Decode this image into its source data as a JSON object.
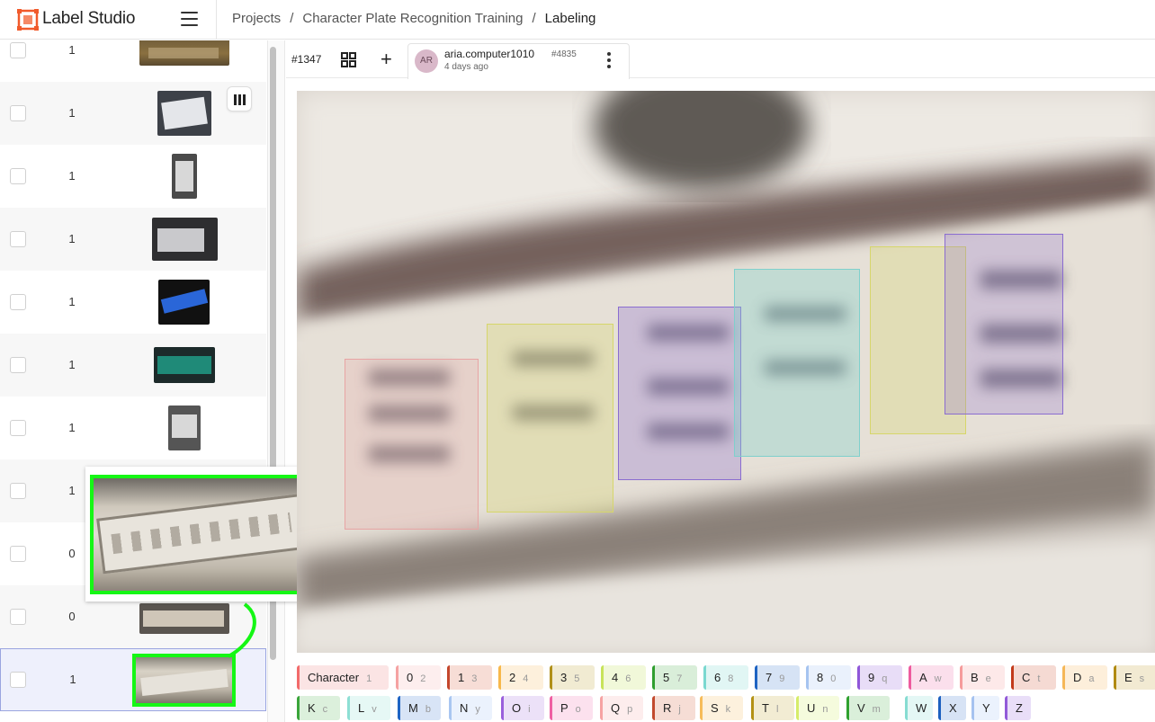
{
  "app": {
    "brand": "Label Studio"
  },
  "breadcrumb": {
    "projects": "Projects",
    "project": "Character Plate Recognition Training",
    "current": "Labeling"
  },
  "tasks": [
    {
      "count": "1"
    },
    {
      "count": "1"
    },
    {
      "count": "1"
    },
    {
      "count": "1"
    },
    {
      "count": "1"
    },
    {
      "count": "1"
    },
    {
      "count": "1"
    },
    {
      "count": "1"
    },
    {
      "count": "0"
    },
    {
      "count": "0"
    },
    {
      "count": "1"
    }
  ],
  "toolbar": {
    "task_id": "#1347"
  },
  "annotation": {
    "avatar": "AR",
    "user": "aria.computer1010",
    "id": "#4835",
    "time": "4 days ago"
  },
  "colors": {
    "accent_green": "#15f715",
    "box_pink": "#e8a4a4",
    "box_yellow": "#d6d66a",
    "box_purple": "#8a6cd0",
    "box_teal": "#7fd0cc"
  },
  "labels": [
    {
      "name": "Character",
      "key": "1",
      "color": "#f26b6b",
      "bg": "#fbe4e4"
    },
    {
      "name": "0",
      "key": "2",
      "color": "#f5a3a3",
      "bg": "#fdeeee"
    },
    {
      "name": "1",
      "key": "3",
      "color": "#c4472d",
      "bg": "#f7ddd6"
    },
    {
      "name": "2",
      "key": "4",
      "color": "#f7b84b",
      "bg": "#fdf0dc"
    },
    {
      "name": "3",
      "key": "5",
      "color": "#b09019",
      "bg": "#f1ebd2"
    },
    {
      "name": "4",
      "key": "6",
      "color": "#c7e35a",
      "bg": "#f1f8d9"
    },
    {
      "name": "5",
      "key": "7",
      "color": "#2f9e2f",
      "bg": "#d9eed9"
    },
    {
      "name": "6",
      "key": "8",
      "color": "#7ad8d0",
      "bg": "#e1f6f4"
    },
    {
      "name": "7",
      "key": "9",
      "color": "#1e63c2",
      "bg": "#d6e3f5"
    },
    {
      "name": "8",
      "key": "0",
      "color": "#a6c4f0",
      "bg": "#eaf1fc"
    },
    {
      "name": "9",
      "key": "q",
      "color": "#8f56d9",
      "bg": "#e8ddf7"
    },
    {
      "name": "A",
      "key": "w",
      "color": "#ee5b9e",
      "bg": "#fbdfec"
    },
    {
      "name": "B",
      "key": "e",
      "color": "#f59b9b",
      "bg": "#fde9e9"
    },
    {
      "name": "C",
      "key": "t",
      "color": "#c23a1a",
      "bg": "#f5dad3"
    },
    {
      "name": "D",
      "key": "a",
      "color": "#f5b757",
      "bg": "#fdefdb"
    },
    {
      "name": "E",
      "key": "s",
      "color": "#b08a12",
      "bg": "#f2ead2"
    },
    {
      "name": "K",
      "key": "c",
      "color": "#3aa53a",
      "bg": "#dcf0dc"
    },
    {
      "name": "L",
      "key": "v",
      "color": "#8ddfd4",
      "bg": "#e6f8f5"
    },
    {
      "name": "M",
      "key": "b",
      "color": "#1f64c4",
      "bg": "#d8e4f6"
    },
    {
      "name": "N",
      "key": "y",
      "color": "#a9c6f1",
      "bg": "#ebf2fd"
    },
    {
      "name": "O",
      "key": "i",
      "color": "#9a5fdc",
      "bg": "#ece1f8"
    },
    {
      "name": "P",
      "key": "o",
      "color": "#ef5fa2",
      "bg": "#fce1ee"
    },
    {
      "name": "Q",
      "key": "p",
      "color": "#f6a3a3",
      "bg": "#fdeded"
    },
    {
      "name": "R",
      "key": "j",
      "color": "#c24a2e",
      "bg": "#f6ddd5"
    },
    {
      "name": "S",
      "key": "k",
      "color": "#f6bc5a",
      "bg": "#fdf1dd"
    },
    {
      "name": "T",
      "key": "l",
      "color": "#b39115",
      "bg": "#f2ecd3"
    },
    {
      "name": "U",
      "key": "n",
      "color": "#d6ec6a",
      "bg": "#f5fbdd"
    },
    {
      "name": "V",
      "key": "m",
      "color": "#2fa12f",
      "bg": "#daefda"
    },
    {
      "name": "W",
      "key": "",
      "color": "#86dcd2",
      "bg": "#e4f7f5"
    },
    {
      "name": "X",
      "key": "",
      "color": "#1c60c0",
      "bg": "#d7e3f5"
    },
    {
      "name": "Y",
      "key": "",
      "color": "#a5c2f0",
      "bg": "#ebf2fd"
    },
    {
      "name": "Z",
      "key": "",
      "color": "#925ad8",
      "bg": "#e9def8"
    }
  ]
}
